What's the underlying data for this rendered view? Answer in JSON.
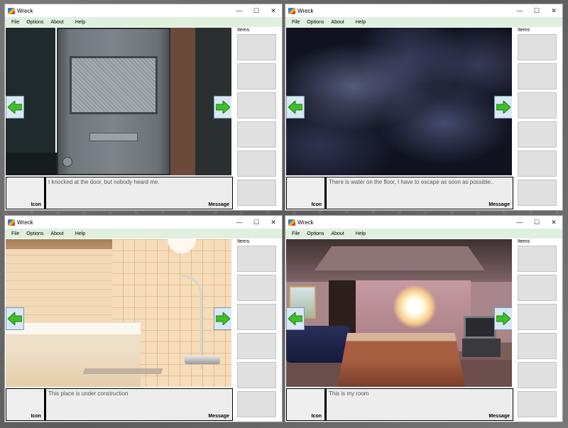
{
  "windows": [
    {
      "title": "Wreck",
      "menu": [
        "File",
        "Options",
        "About",
        "Help"
      ],
      "items_label": "Items",
      "icon_label": "Icon",
      "message_label": "Message",
      "message_text": "I knocked at the door, but nobody heard me.",
      "scene": "door"
    },
    {
      "title": "Wreck",
      "menu": [
        "File",
        "Options",
        "About",
        "Help"
      ],
      "items_label": "Items",
      "icon_label": "Icon",
      "message_label": "Message",
      "message_text": "There is water on the floor, I have to escape as soon as possible..",
      "scene": "dark"
    },
    {
      "title": "Wreck",
      "menu": [
        "File",
        "Options",
        "About",
        "Help"
      ],
      "items_label": "Items",
      "icon_label": "Icon",
      "message_label": "Message",
      "message_text": "This place is under construction",
      "scene": "bathroom"
    },
    {
      "title": "Wreck",
      "menu": [
        "File",
        "Options",
        "About",
        "Help"
      ],
      "items_label": "Items",
      "icon_label": "Icon",
      "message_label": "Message",
      "message_text": "This is my room",
      "scene": "bedroom"
    }
  ],
  "window_controls": {
    "minimize": "—",
    "maximize": "☐",
    "close": "✕"
  },
  "colors": {
    "menubar": "#dff0df",
    "arrow_green": "#3fbf2a",
    "panel_border": "#000000"
  }
}
